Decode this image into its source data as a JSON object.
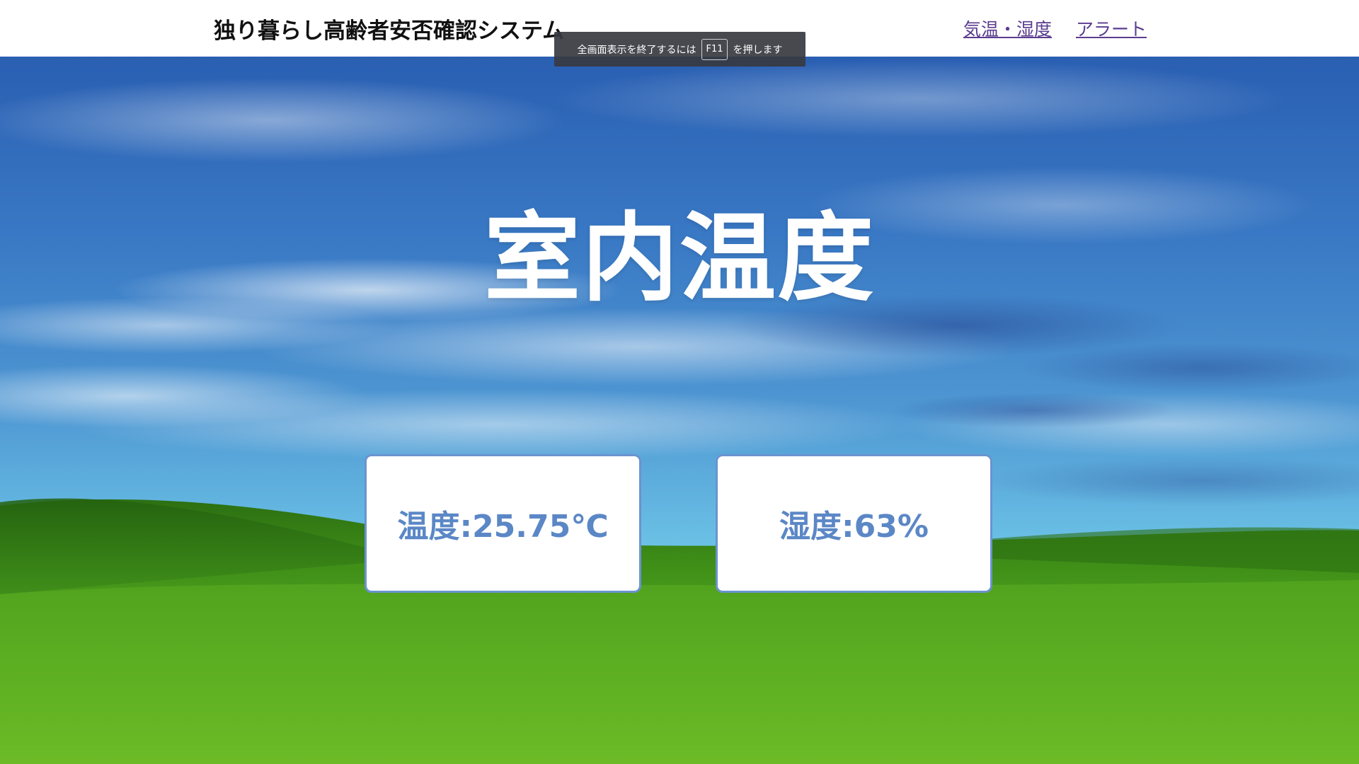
{
  "header": {
    "title": "独り暮らし高齢者安否確認システム",
    "nav": [
      {
        "label": "気温・湿度"
      },
      {
        "label": "アラート"
      }
    ]
  },
  "fullscreen_notice": {
    "before": "全画面表示を終了するには",
    "key": "F11",
    "after": "を押します"
  },
  "main": {
    "heading": "室内温度",
    "cards": [
      {
        "label": "温度:25.75℃"
      },
      {
        "label": "湿度:63%"
      }
    ]
  },
  "background": {
    "description_icon": "sky-meadow-wallpaper",
    "colors": {
      "sky_top": "#2d62b4",
      "sky_mid": "#5fa3d6",
      "sky_horizon": "#6cc3e3",
      "grass_top": "#2f7d14",
      "grass_bottom": "#7bc62a"
    }
  },
  "colors": {
    "accent": "#5b87c6",
    "card_border": "#6b93cf",
    "nav_link": "#5a3c8f"
  }
}
